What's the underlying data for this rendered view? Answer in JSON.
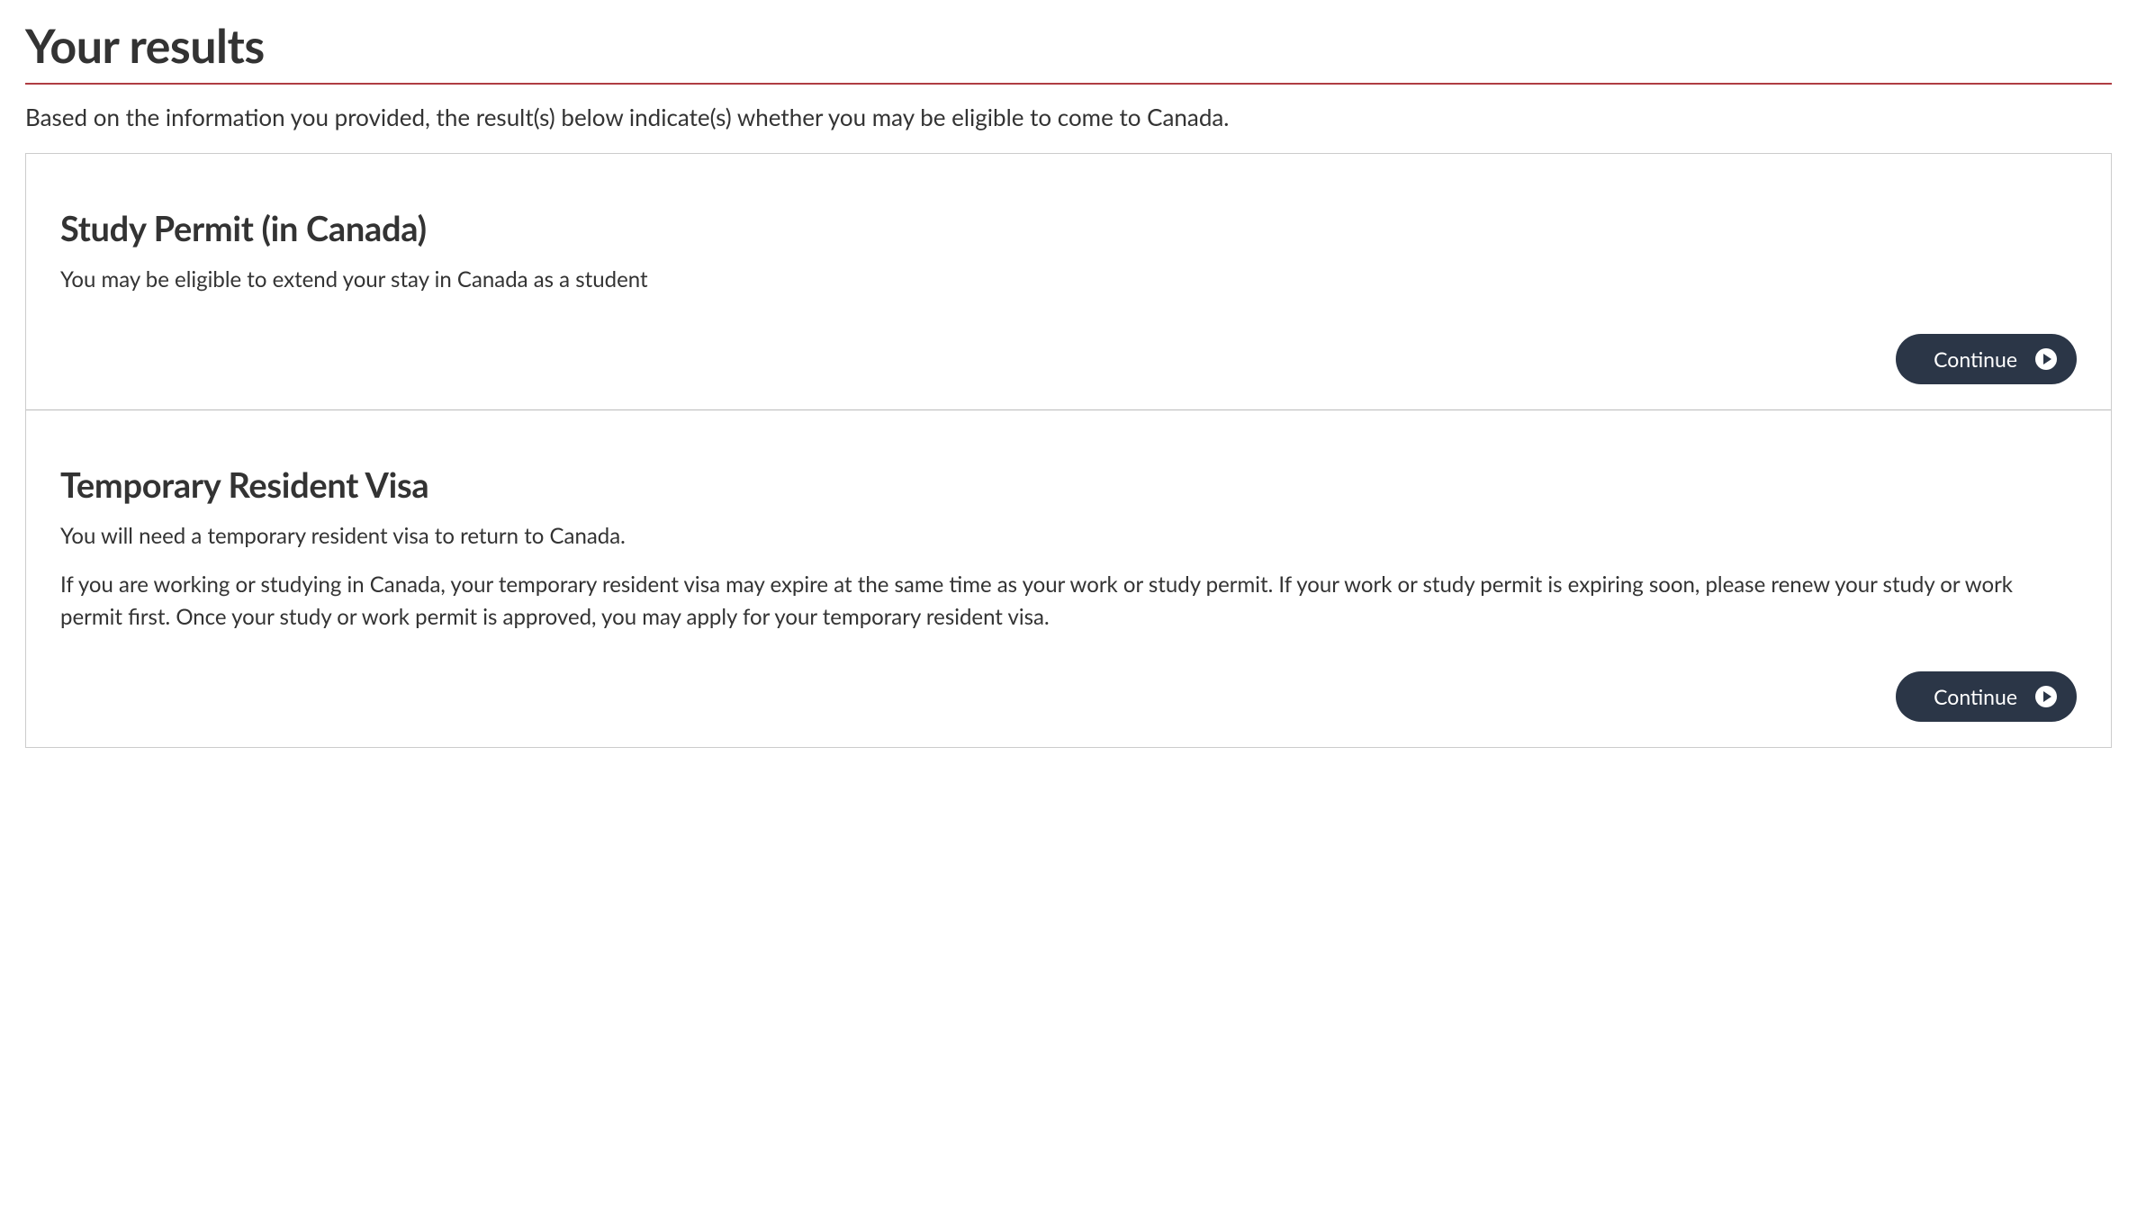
{
  "page": {
    "title": "Your results",
    "intro": "Based on the information you provided, the result(s) below indicate(s) whether you may be eligible to come to Canada."
  },
  "results": [
    {
      "title": "Study Permit (in Canada)",
      "paragraphs": [
        "You may be eligible to extend your stay in Canada as a student"
      ],
      "button_label": "Continue"
    },
    {
      "title": "Temporary Resident Visa",
      "paragraphs": [
        "You will need a temporary resident visa to return to Canada.",
        "If you are working or studying in Canada, your temporary resident visa may expire at the same time as your work or study permit. If your work or study permit is expiring soon, please renew your study or work permit first. Once your study or work permit is approved, you may apply for your temporary resident visa."
      ],
      "button_label": "Continue"
    }
  ]
}
